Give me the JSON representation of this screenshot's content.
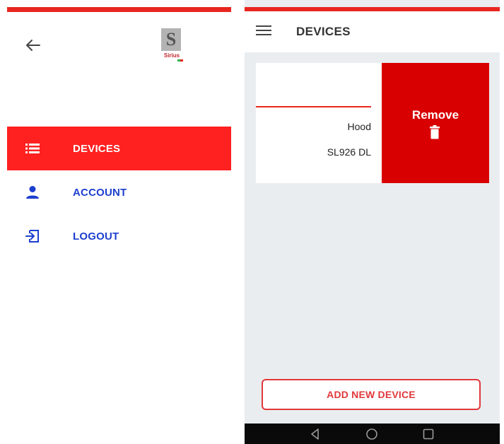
{
  "drawer": {
    "logo": {
      "mark": "S",
      "word": "Sirius"
    },
    "menu": [
      {
        "label": "DEVICES",
        "icon": "list-icon",
        "selected": true
      },
      {
        "label": "ACCOUNT",
        "icon": "person-icon",
        "selected": false
      },
      {
        "label": "LOGOUT",
        "icon": "logout-icon",
        "selected": false
      }
    ]
  },
  "devices_screen": {
    "title": "DEVICES",
    "device": {
      "name": "Hood",
      "model": "SL926 DL"
    },
    "remove_label": "Remove",
    "add_button_label": "ADD NEW DEVICE"
  },
  "colors": {
    "accent_red": "#e8261f",
    "selected_bg": "#ff2020",
    "remove_bg": "#d80000",
    "link_blue": "#1d3fcf",
    "screen_bg": "#eaedf0"
  }
}
